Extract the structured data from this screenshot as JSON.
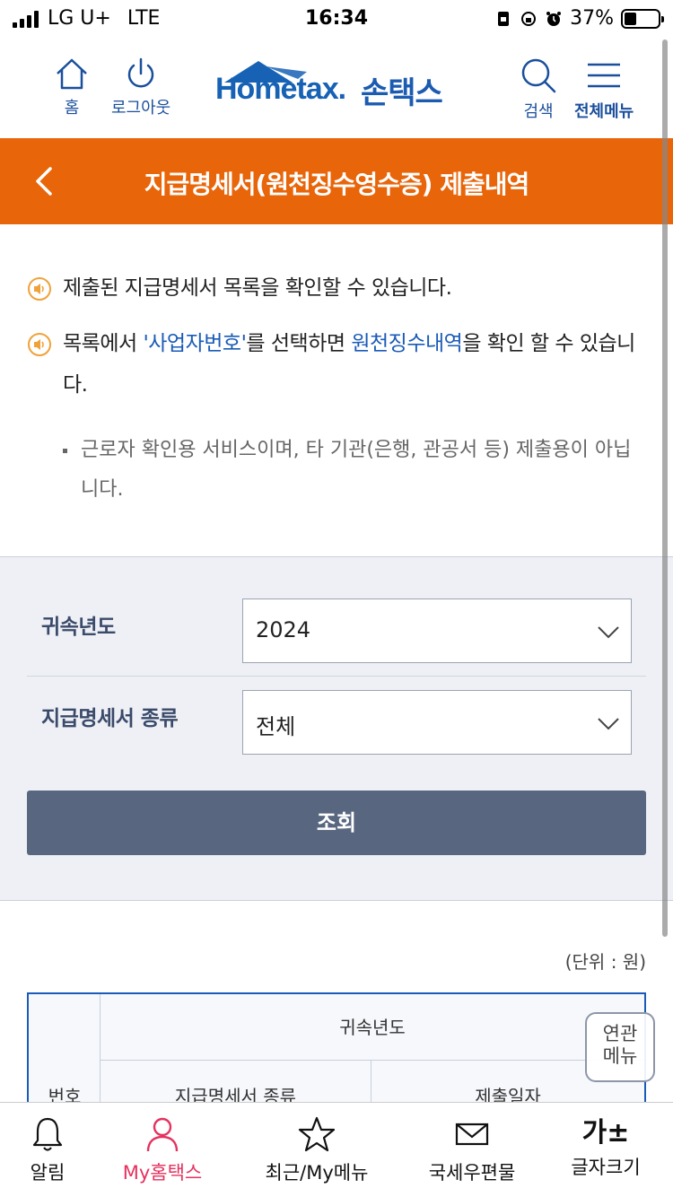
{
  "status_bar": {
    "carrier": "LG U+",
    "network": "LTE",
    "time": "16:34",
    "battery": "37%",
    "battery_level": 0.37
  },
  "header": {
    "home_label": "홈",
    "logout_label": "로그아웃",
    "logo_text": "Hometax.",
    "logo_kr": "손택스",
    "search_label": "검색",
    "menu_label": "전체메뉴"
  },
  "page": {
    "title": "지급명세서(원천징수영수증) 제출내역"
  },
  "info": {
    "notice1": "제출된 지급명세서 목록을 확인할 수 있습니다.",
    "notice2_pre": "목록에서 ",
    "notice2_link1": "'사업자번호'",
    "notice2_mid": "를 선택하면 ",
    "notice2_link2": "원천징수내역",
    "notice2_post": "을 확인 할 수 있습니다.",
    "subnote": "근로자 확인용 서비스이며, 타 기관(은행, 관공서 등) 제출용이 아닙니다."
  },
  "search": {
    "year_label": "귀속년도",
    "year_value": "2024",
    "kind_label": "지급명세서 종류",
    "kind_value": "전체",
    "submit_label": "조회"
  },
  "results": {
    "unit": "(단위 : 원)",
    "col_no": "번호",
    "col_year": "귀속년도",
    "col_kind": "지급명세서 종류",
    "col_date": "제출일자"
  },
  "related_menu": "연관 메뉴",
  "related_menu_line1": "연관",
  "related_menu_line2": "메뉴",
  "tabbar": {
    "items": [
      {
        "label": "알림",
        "icon": "bell-icon"
      },
      {
        "label": "My홈택스",
        "icon": "person-icon"
      },
      {
        "label": "최근/My메뉴",
        "icon": "star-icon"
      },
      {
        "label": "국세우편물",
        "icon": "mail-icon"
      },
      {
        "label": "글자크기",
        "icon": "font-size-icon",
        "glyph": "가±"
      }
    ],
    "active_index": 1
  },
  "colors": {
    "accent_orange": "#e8650a",
    "brand_blue": "#1a5bb7",
    "button_gray": "#58667f",
    "active_tab": "#e4325f"
  }
}
